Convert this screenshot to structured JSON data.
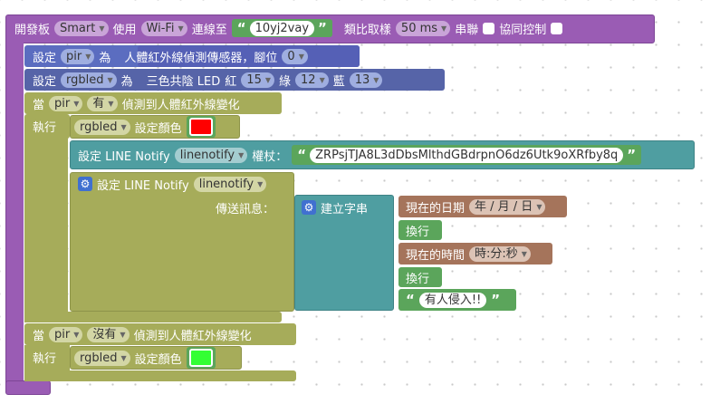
{
  "colors": {
    "board_purple": "#9a5cb4",
    "pir_blue": "#5b6dc0",
    "event_olive": "#a6ac5a",
    "line_teal": "#4f9ea1",
    "text_green": "#5ba55b",
    "date_brown": "#a5745b",
    "rgb_navy": "#5664a8"
  },
  "board": {
    "label1": "開發板",
    "board_select": "Smart",
    "label2": "使用",
    "net_select": "Wi-Fi",
    "label3": "連線至",
    "ssid": "10yj2vay",
    "label4": "類比取樣",
    "sample_select": "50 ms",
    "label5": "串聯",
    "label6": "協同控制"
  },
  "pir_setup": {
    "label1": "設定",
    "var": "pir",
    "label2": "為",
    "label3": "人體紅外線偵測傳感器，腳位",
    "pin": "0"
  },
  "led_setup": {
    "label1": "設定",
    "var": "rgbled",
    "label2": "為",
    "label3": "三色共陰 LED",
    "r_label": "紅",
    "r": "15",
    "g_label": "綠",
    "g": "12",
    "b_label": "藍",
    "b": "13"
  },
  "event1": {
    "when": "當",
    "var": "pir",
    "state": "有",
    "label": "偵測到人體紅外線變化",
    "exec": "執行",
    "led_var": "rgbled",
    "set_color": "設定顏色",
    "color": "#ff0000"
  },
  "line_set": {
    "label": "設定 LINE Notify",
    "var": "linenotify",
    "token_label": "權杖：",
    "token": "ZRPsjTJA8L3dDbsMlthdGBdrpnO6dz6Utk9oXRfby8q"
  },
  "line_send": {
    "label": "設定 LINE Notify",
    "var": "linenotify",
    "msg_label": "傳送訊息：",
    "build": "建立字串",
    "date_label": "現在的日期",
    "date_fmt": "年 / 月 / 日",
    "newline1": "換行",
    "time_label": "現在的時間",
    "time_fmt": "時:分:秒",
    "newline2": "換行",
    "text": "有人侵入!!"
  },
  "event2": {
    "when": "當",
    "var": "pir",
    "state": "沒有",
    "label": "偵測到人體紅外線變化",
    "exec": "執行",
    "led_var": "rgbled",
    "set_color": "設定顏色",
    "color": "#33ff33"
  }
}
